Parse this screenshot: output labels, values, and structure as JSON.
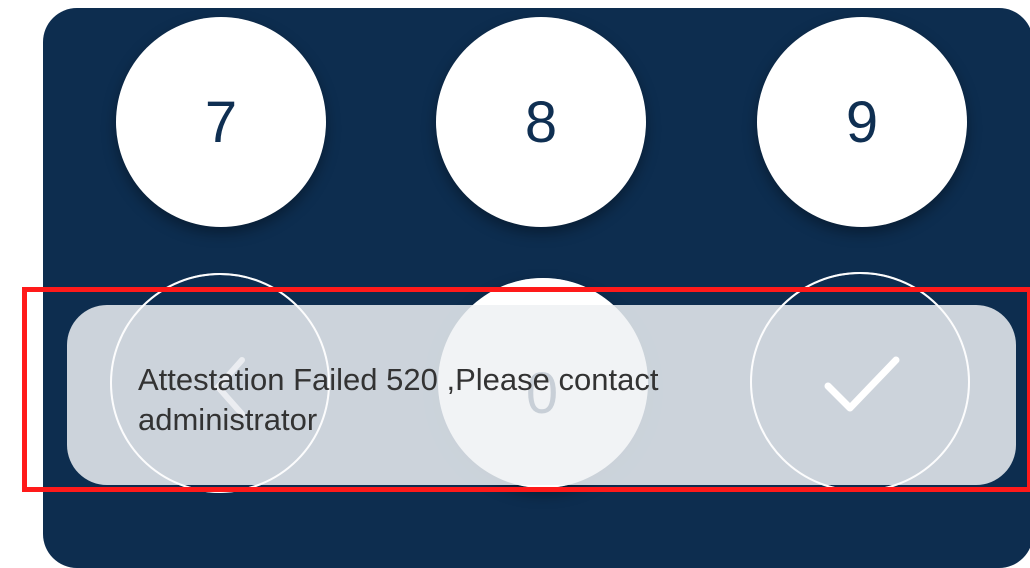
{
  "keypad": {
    "row1": [
      "7",
      "8",
      "9"
    ],
    "zero": "0",
    "colors": {
      "panel": "#0d2d4f",
      "key_bg": "#ffffff",
      "key_text": "#0f2f52",
      "toast_bg": "#dce2e7",
      "highlight": "#ff1a1a"
    },
    "icons": {
      "backspace": "chevron-left-icon",
      "confirm": "checkmark-icon"
    }
  },
  "toast": {
    "message": "Attestation Failed 520 ,Please contact administrator"
  }
}
